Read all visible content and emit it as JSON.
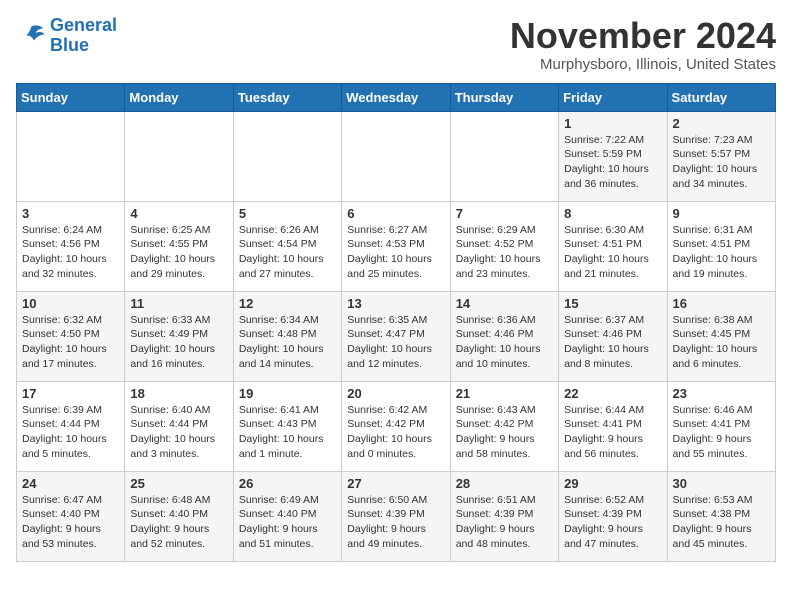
{
  "header": {
    "logo_line1": "General",
    "logo_line2": "Blue",
    "month": "November 2024",
    "location": "Murphysboro, Illinois, United States"
  },
  "days_of_week": [
    "Sunday",
    "Monday",
    "Tuesday",
    "Wednesday",
    "Thursday",
    "Friday",
    "Saturday"
  ],
  "weeks": [
    [
      {
        "day": "",
        "info": ""
      },
      {
        "day": "",
        "info": ""
      },
      {
        "day": "",
        "info": ""
      },
      {
        "day": "",
        "info": ""
      },
      {
        "day": "",
        "info": ""
      },
      {
        "day": "1",
        "info": "Sunrise: 7:22 AM\nSunset: 5:59 PM\nDaylight: 10 hours\nand 36 minutes."
      },
      {
        "day": "2",
        "info": "Sunrise: 7:23 AM\nSunset: 5:57 PM\nDaylight: 10 hours\nand 34 minutes."
      }
    ],
    [
      {
        "day": "3",
        "info": "Sunrise: 6:24 AM\nSunset: 4:56 PM\nDaylight: 10 hours\nand 32 minutes."
      },
      {
        "day": "4",
        "info": "Sunrise: 6:25 AM\nSunset: 4:55 PM\nDaylight: 10 hours\nand 29 minutes."
      },
      {
        "day": "5",
        "info": "Sunrise: 6:26 AM\nSunset: 4:54 PM\nDaylight: 10 hours\nand 27 minutes."
      },
      {
        "day": "6",
        "info": "Sunrise: 6:27 AM\nSunset: 4:53 PM\nDaylight: 10 hours\nand 25 minutes."
      },
      {
        "day": "7",
        "info": "Sunrise: 6:29 AM\nSunset: 4:52 PM\nDaylight: 10 hours\nand 23 minutes."
      },
      {
        "day": "8",
        "info": "Sunrise: 6:30 AM\nSunset: 4:51 PM\nDaylight: 10 hours\nand 21 minutes."
      },
      {
        "day": "9",
        "info": "Sunrise: 6:31 AM\nSunset: 4:51 PM\nDaylight: 10 hours\nand 19 minutes."
      }
    ],
    [
      {
        "day": "10",
        "info": "Sunrise: 6:32 AM\nSunset: 4:50 PM\nDaylight: 10 hours\nand 17 minutes."
      },
      {
        "day": "11",
        "info": "Sunrise: 6:33 AM\nSunset: 4:49 PM\nDaylight: 10 hours\nand 16 minutes."
      },
      {
        "day": "12",
        "info": "Sunrise: 6:34 AM\nSunset: 4:48 PM\nDaylight: 10 hours\nand 14 minutes."
      },
      {
        "day": "13",
        "info": "Sunrise: 6:35 AM\nSunset: 4:47 PM\nDaylight: 10 hours\nand 12 minutes."
      },
      {
        "day": "14",
        "info": "Sunrise: 6:36 AM\nSunset: 4:46 PM\nDaylight: 10 hours\nand 10 minutes."
      },
      {
        "day": "15",
        "info": "Sunrise: 6:37 AM\nSunset: 4:46 PM\nDaylight: 10 hours\nand 8 minutes."
      },
      {
        "day": "16",
        "info": "Sunrise: 6:38 AM\nSunset: 4:45 PM\nDaylight: 10 hours\nand 6 minutes."
      }
    ],
    [
      {
        "day": "17",
        "info": "Sunrise: 6:39 AM\nSunset: 4:44 PM\nDaylight: 10 hours\nand 5 minutes."
      },
      {
        "day": "18",
        "info": "Sunrise: 6:40 AM\nSunset: 4:44 PM\nDaylight: 10 hours\nand 3 minutes."
      },
      {
        "day": "19",
        "info": "Sunrise: 6:41 AM\nSunset: 4:43 PM\nDaylight: 10 hours\nand 1 minute."
      },
      {
        "day": "20",
        "info": "Sunrise: 6:42 AM\nSunset: 4:42 PM\nDaylight: 10 hours\nand 0 minutes."
      },
      {
        "day": "21",
        "info": "Sunrise: 6:43 AM\nSunset: 4:42 PM\nDaylight: 9 hours\nand 58 minutes."
      },
      {
        "day": "22",
        "info": "Sunrise: 6:44 AM\nSunset: 4:41 PM\nDaylight: 9 hours\nand 56 minutes."
      },
      {
        "day": "23",
        "info": "Sunrise: 6:46 AM\nSunset: 4:41 PM\nDaylight: 9 hours\nand 55 minutes."
      }
    ],
    [
      {
        "day": "24",
        "info": "Sunrise: 6:47 AM\nSunset: 4:40 PM\nDaylight: 9 hours\nand 53 minutes."
      },
      {
        "day": "25",
        "info": "Sunrise: 6:48 AM\nSunset: 4:40 PM\nDaylight: 9 hours\nand 52 minutes."
      },
      {
        "day": "26",
        "info": "Sunrise: 6:49 AM\nSunset: 4:40 PM\nDaylight: 9 hours\nand 51 minutes."
      },
      {
        "day": "27",
        "info": "Sunrise: 6:50 AM\nSunset: 4:39 PM\nDaylight: 9 hours\nand 49 minutes."
      },
      {
        "day": "28",
        "info": "Sunrise: 6:51 AM\nSunset: 4:39 PM\nDaylight: 9 hours\nand 48 minutes."
      },
      {
        "day": "29",
        "info": "Sunrise: 6:52 AM\nSunset: 4:39 PM\nDaylight: 9 hours\nand 47 minutes."
      },
      {
        "day": "30",
        "info": "Sunrise: 6:53 AM\nSunset: 4:38 PM\nDaylight: 9 hours\nand 45 minutes."
      }
    ]
  ]
}
